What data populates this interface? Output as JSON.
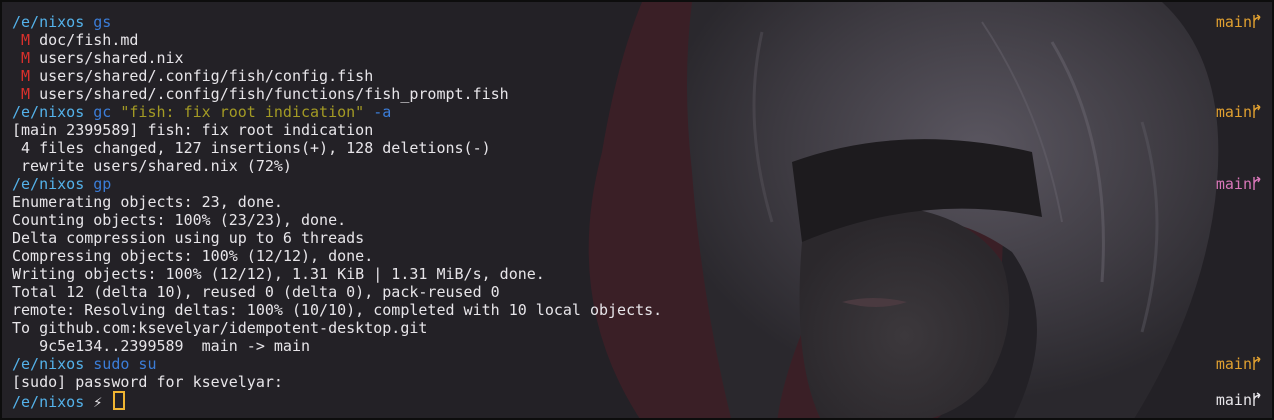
{
  "terminal": {
    "colors": {
      "background": "#232126",
      "text": "#e7e5e9",
      "cwd": "#54b2ea",
      "command": "#3b7dd8",
      "string": "#a39a24",
      "modified": "#d9302c",
      "branch_clean": "#e0a030",
      "branch_push": "#d876b8",
      "cursor": "#f0b532"
    },
    "prompt1": {
      "cwd": "/e/nixos",
      "command": "gs",
      "branch": "main"
    },
    "status": {
      "marker": "M",
      "files": [
        "doc/fish.md",
        "users/shared.nix",
        "users/shared/.config/fish/config.fish",
        "users/shared/.config/fish/functions/fish_prompt.fish"
      ]
    },
    "prompt2": {
      "cwd": "/e/nixos",
      "command": "gc",
      "arg": "\"fish: fix root indication\"",
      "flag": "-a",
      "branch": "main"
    },
    "commit_output": [
      "[main 2399589] fish: fix root indication",
      " 4 files changed, 127 insertions(+), 128 deletions(-)",
      " rewrite users/shared.nix (72%)"
    ],
    "prompt3": {
      "cwd": "/e/nixos",
      "command": "gp",
      "branch": "main"
    },
    "push_output": [
      "Enumerating objects: 23, done.",
      "Counting objects: 100% (23/23), done.",
      "Delta compression using up to 6 threads",
      "Compressing objects: 100% (12/12), done.",
      "Writing objects: 100% (12/12), 1.31 KiB | 1.31 MiB/s, done.",
      "Total 12 (delta 10), reused 0 (delta 0), pack-reused 0",
      "remote: Resolving deltas: 100% (10/10), completed with 10 local objects.",
      "To github.com:ksevelyar/idempotent-desktop.git",
      "   9c5e134..2399589  main -> main"
    ],
    "prompt4": {
      "cwd": "/e/nixos",
      "command": "sudo su",
      "branch": "main"
    },
    "sudo_prompt": "[sudo] password for ksevelyar:",
    "prompt5": {
      "cwd": "/e/nixos",
      "symbol": "⚡",
      "branch": "main"
    },
    "icons": {
      "branch": "git-branch-icon",
      "root": "lightning-icon",
      "cursor": "block-cursor"
    }
  }
}
